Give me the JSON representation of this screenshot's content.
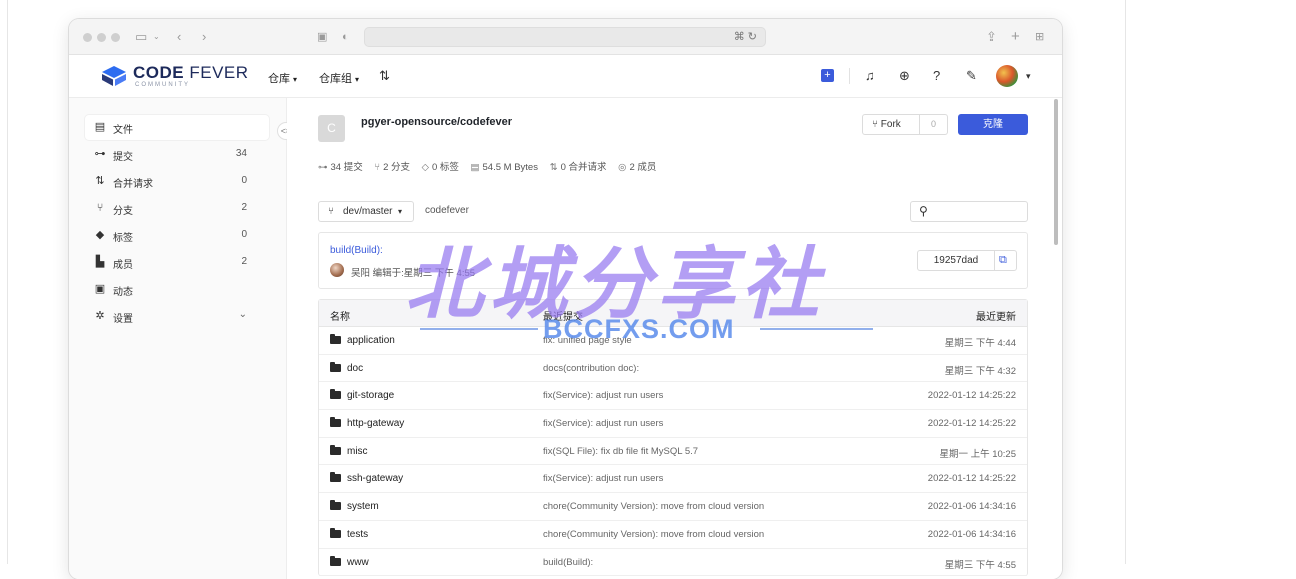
{
  "browser": {
    "url": ""
  },
  "header": {
    "logo_main": "CODE",
    "logo_light": "FEVER",
    "logo_sub": "COMMUNITY",
    "nav": [
      {
        "label": "仓库"
      },
      {
        "label": "仓库组"
      }
    ]
  },
  "sidebar": {
    "items": [
      {
        "icon": "file-icon",
        "label": "文件",
        "count": ""
      },
      {
        "icon": "commit-icon",
        "label": "提交",
        "count": "34"
      },
      {
        "icon": "merge-request-icon",
        "label": "合并请求",
        "count": "0"
      },
      {
        "icon": "branch-icon",
        "label": "分支",
        "count": "2"
      },
      {
        "icon": "tag-icon",
        "label": "标签",
        "count": "0"
      },
      {
        "icon": "members-icon",
        "label": "成员",
        "count": "2"
      },
      {
        "icon": "activity-icon",
        "label": "动态",
        "count": ""
      },
      {
        "icon": "settings-icon",
        "label": "设置",
        "count": ""
      }
    ]
  },
  "repo": {
    "avatar_letter": "C",
    "name": "pgyer-opensource/codefever",
    "fork_label": "Fork",
    "fork_count": "0",
    "clone_label": "克隆",
    "stats": {
      "commits": "34 提交",
      "branches": "2 分支",
      "tags": "0 标签",
      "size": "54.5 M Bytes",
      "merge_requests": "0 合并请求",
      "members": "2 成员"
    },
    "branch": "dev/master",
    "path": "codefever"
  },
  "last_commit": {
    "message": "build(Build):",
    "author_line": "吴阳  编辑于:星期三 下午 4:55",
    "hash": "19257dad"
  },
  "table": {
    "headers": {
      "name": "名称",
      "commit": "最近提交",
      "updated": "最近更新"
    },
    "rows": [
      {
        "name": "application",
        "commit": "fix: unified page style",
        "date": "星期三 下午 4:44"
      },
      {
        "name": "doc",
        "commit": "docs(contribution doc):",
        "date": "星期三 下午 4:32"
      },
      {
        "name": "git-storage",
        "commit": "fix(Service): adjust run users",
        "date": "2022-01-12 14:25:22"
      },
      {
        "name": "http-gateway",
        "commit": "fix(Service): adjust run users",
        "date": "2022-01-12 14:25:22"
      },
      {
        "name": "misc",
        "commit": "fix(SQL File): fix db file fit MySQL 5.7",
        "date": "星期一 上午 10:25"
      },
      {
        "name": "ssh-gateway",
        "commit": "fix(Service): adjust run users",
        "date": "2022-01-12 14:25:22"
      },
      {
        "name": "system",
        "commit": "chore(Community Version): move from cloud version",
        "date": "2022-01-06 14:34:16"
      },
      {
        "name": "tests",
        "commit": "chore(Community Version): move from cloud version",
        "date": "2022-01-06 14:34:16"
      },
      {
        "name": "www",
        "commit": "build(Build):",
        "date": "星期三 下午 4:55"
      }
    ]
  },
  "watermark": {
    "big": "北城分享社",
    "small": "BCCFXS.COM"
  },
  "colors": {
    "accent": "#3b5bdb",
    "sidebar_bg": "#fafafa"
  }
}
